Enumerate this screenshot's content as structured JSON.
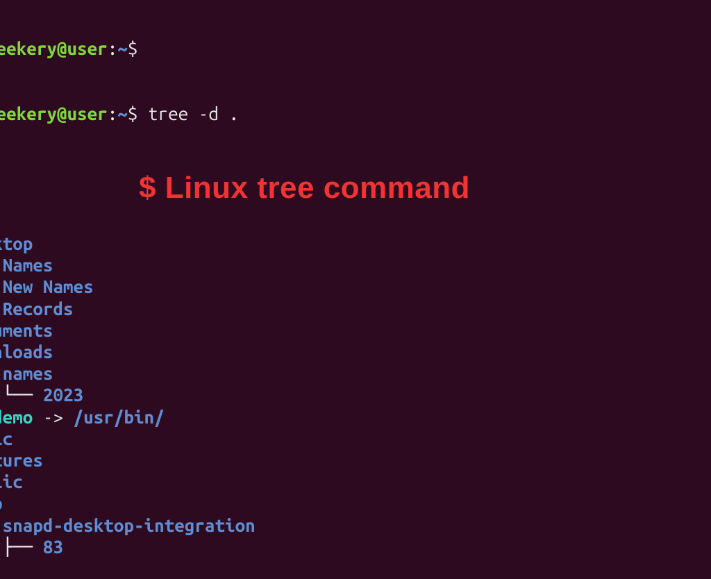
{
  "prompt": {
    "user": "geekery@user",
    "separator": ":",
    "path": "~",
    "symbol": "$",
    "command": "tree -d .",
    "prev_suffix": ":~$"
  },
  "tree": {
    "lines": [
      {
        "branch": "",
        "name": "esktop",
        "cls": "blue"
      },
      {
        "branch": "── ",
        "name": "Names",
        "cls": "blue"
      },
      {
        "branch": "── ",
        "name": "New Names",
        "cls": "blue"
      },
      {
        "branch": "── ",
        "name": "Records",
        "cls": "blue"
      },
      {
        "branch": "",
        "name": "ocuments",
        "cls": "blue"
      },
      {
        "branch": "",
        "name": "ownloads",
        "cls": "blue"
      },
      {
        "branch": "── ",
        "name": "names",
        "cls": "blue"
      },
      {
        "branch": "   └── ",
        "name": "2023",
        "cls": "blue"
      },
      {
        "branch": "",
        "name": "s_demo",
        "cls": "teal",
        "arrow": " -> ",
        "target": "/usr/bin/",
        "target_cls": "blue"
      },
      {
        "branch": "",
        "name": "usic",
        "cls": "blue"
      },
      {
        "branch": "",
        "name": "ictures",
        "cls": "blue"
      },
      {
        "branch": "",
        "name": "ublic",
        "cls": "blue"
      },
      {
        "branch": "",
        "name": "nap",
        "cls": "blue"
      },
      {
        "branch": "── ",
        "name": "snapd-desktop-integration",
        "cls": "blue"
      },
      {
        "branch": "   ├── ",
        "name": "83",
        "cls": "blue"
      }
    ]
  },
  "overlay": {
    "title": "$ Linux tree command"
  }
}
